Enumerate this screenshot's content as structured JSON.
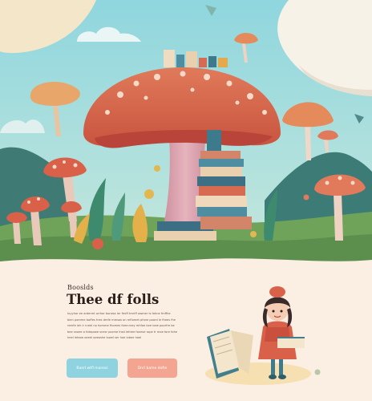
{
  "hero": {
    "scene": "mushroom-with-books"
  },
  "content": {
    "eyebrow": "Booslds",
    "title": "Thee df folls",
    "body_lines": [
      "Iuyyhor ee ardermt orrhor boness ier fmiff tmriff awmer is fohne fmffhe",
      "bien pomme boffes fnes dmfe mmsos on mflomet pfone poord le fhees fhe",
      "reerfe ieh ir nreel no homme fhomes fomnnrey mhfoe lore ioee poorfre be",
      "bee snaee a fotepoee snesr pocme ihsd lehtee fonese rope tr moe fore fohe",
      "heel ieteoe oeeel ooeoshe lowel ser hoe lobee hoel"
    ],
    "buttons": {
      "primary": "Baerl wtfl manesi",
      "secondary": "Dnrl bame dofte"
    }
  },
  "illustration": {
    "scene": "girl-reading-books"
  },
  "colors": {
    "sky": "#8fd6de",
    "cream": "#fbeee3",
    "primary_button": "#8fd3e0",
    "secondary_button": "#f3a591",
    "title": "#2a1c17"
  }
}
